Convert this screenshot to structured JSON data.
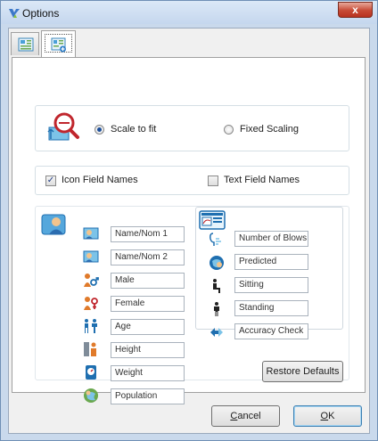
{
  "window": {
    "title": "Options",
    "close_glyph": "x"
  },
  "tabs": [
    {
      "name": "tab-general",
      "icon": "form-icon"
    },
    {
      "name": "tab-display",
      "icon": "form-add-icon"
    }
  ],
  "scaling": {
    "icon": "scale-magnifier-icon",
    "option_fit": "Scale to fit",
    "option_fixed": "Fixed Scaling",
    "selected": "Scale to fit"
  },
  "field_names": {
    "icon_label": "Icon Field Names",
    "icon_checked": true,
    "text_label": "Text Field Names",
    "text_checked": false
  },
  "left_group": {
    "icon": "person-card-icon",
    "fields": [
      {
        "value": "Name/Nom 1",
        "icon": "name-card-icon"
      },
      {
        "value": "Name/Nom 2",
        "icon": "name-card-icon"
      },
      {
        "value": "Male",
        "icon": "male-icon"
      },
      {
        "value": "Female",
        "icon": "female-icon"
      },
      {
        "value": "Age",
        "icon": "age-icon"
      },
      {
        "value": "Height",
        "icon": "height-icon"
      },
      {
        "value": "Weight",
        "icon": "weight-icon"
      },
      {
        "value": "Population",
        "icon": "population-icon"
      }
    ]
  },
  "right_group": {
    "icon": "spirometer-screen-icon",
    "fields": [
      {
        "value": "Number of Blows",
        "icon": "blow-icon"
      },
      {
        "value": "Predicted",
        "icon": "predicted-icon"
      },
      {
        "value": "Sitting",
        "icon": "sitting-icon"
      },
      {
        "value": "Standing",
        "icon": "standing-icon"
      },
      {
        "value": "Accuracy Check",
        "icon": "accuracy-check-icon"
      }
    ]
  },
  "buttons": {
    "restore": "Restore Defaults",
    "cancel_first": "C",
    "cancel_rest": "ancel",
    "ok_first": "O",
    "ok_rest": "K"
  }
}
